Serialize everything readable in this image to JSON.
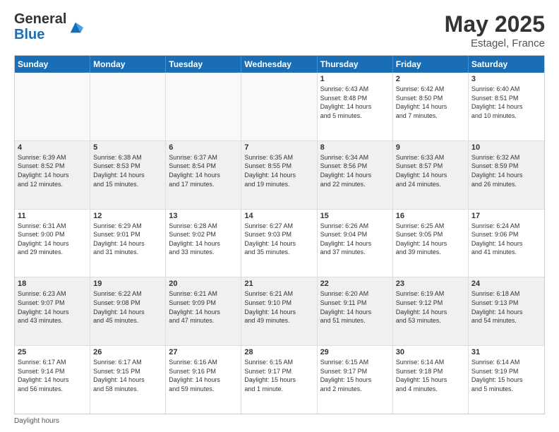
{
  "header": {
    "logo_general": "General",
    "logo_blue": "Blue",
    "month_year": "May 2025",
    "location": "Estagel, France"
  },
  "days_of_week": [
    "Sunday",
    "Monday",
    "Tuesday",
    "Wednesday",
    "Thursday",
    "Friday",
    "Saturday"
  ],
  "weeks": [
    [
      {
        "day": "",
        "info": "",
        "empty": true
      },
      {
        "day": "",
        "info": "",
        "empty": true
      },
      {
        "day": "",
        "info": "",
        "empty": true
      },
      {
        "day": "",
        "info": "",
        "empty": true
      },
      {
        "day": "1",
        "info": "Sunrise: 6:43 AM\nSunset: 8:48 PM\nDaylight: 14 hours\nand 5 minutes."
      },
      {
        "day": "2",
        "info": "Sunrise: 6:42 AM\nSunset: 8:50 PM\nDaylight: 14 hours\nand 7 minutes."
      },
      {
        "day": "3",
        "info": "Sunrise: 6:40 AM\nSunset: 8:51 PM\nDaylight: 14 hours\nand 10 minutes."
      }
    ],
    [
      {
        "day": "4",
        "info": "Sunrise: 6:39 AM\nSunset: 8:52 PM\nDaylight: 14 hours\nand 12 minutes."
      },
      {
        "day": "5",
        "info": "Sunrise: 6:38 AM\nSunset: 8:53 PM\nDaylight: 14 hours\nand 15 minutes."
      },
      {
        "day": "6",
        "info": "Sunrise: 6:37 AM\nSunset: 8:54 PM\nDaylight: 14 hours\nand 17 minutes."
      },
      {
        "day": "7",
        "info": "Sunrise: 6:35 AM\nSunset: 8:55 PM\nDaylight: 14 hours\nand 19 minutes."
      },
      {
        "day": "8",
        "info": "Sunrise: 6:34 AM\nSunset: 8:56 PM\nDaylight: 14 hours\nand 22 minutes."
      },
      {
        "day": "9",
        "info": "Sunrise: 6:33 AM\nSunset: 8:57 PM\nDaylight: 14 hours\nand 24 minutes."
      },
      {
        "day": "10",
        "info": "Sunrise: 6:32 AM\nSunset: 8:59 PM\nDaylight: 14 hours\nand 26 minutes."
      }
    ],
    [
      {
        "day": "11",
        "info": "Sunrise: 6:31 AM\nSunset: 9:00 PM\nDaylight: 14 hours\nand 29 minutes."
      },
      {
        "day": "12",
        "info": "Sunrise: 6:29 AM\nSunset: 9:01 PM\nDaylight: 14 hours\nand 31 minutes."
      },
      {
        "day": "13",
        "info": "Sunrise: 6:28 AM\nSunset: 9:02 PM\nDaylight: 14 hours\nand 33 minutes."
      },
      {
        "day": "14",
        "info": "Sunrise: 6:27 AM\nSunset: 9:03 PM\nDaylight: 14 hours\nand 35 minutes."
      },
      {
        "day": "15",
        "info": "Sunrise: 6:26 AM\nSunset: 9:04 PM\nDaylight: 14 hours\nand 37 minutes."
      },
      {
        "day": "16",
        "info": "Sunrise: 6:25 AM\nSunset: 9:05 PM\nDaylight: 14 hours\nand 39 minutes."
      },
      {
        "day": "17",
        "info": "Sunrise: 6:24 AM\nSunset: 9:06 PM\nDaylight: 14 hours\nand 41 minutes."
      }
    ],
    [
      {
        "day": "18",
        "info": "Sunrise: 6:23 AM\nSunset: 9:07 PM\nDaylight: 14 hours\nand 43 minutes."
      },
      {
        "day": "19",
        "info": "Sunrise: 6:22 AM\nSunset: 9:08 PM\nDaylight: 14 hours\nand 45 minutes."
      },
      {
        "day": "20",
        "info": "Sunrise: 6:21 AM\nSunset: 9:09 PM\nDaylight: 14 hours\nand 47 minutes."
      },
      {
        "day": "21",
        "info": "Sunrise: 6:21 AM\nSunset: 9:10 PM\nDaylight: 14 hours\nand 49 minutes."
      },
      {
        "day": "22",
        "info": "Sunrise: 6:20 AM\nSunset: 9:11 PM\nDaylight: 14 hours\nand 51 minutes."
      },
      {
        "day": "23",
        "info": "Sunrise: 6:19 AM\nSunset: 9:12 PM\nDaylight: 14 hours\nand 53 minutes."
      },
      {
        "day": "24",
        "info": "Sunrise: 6:18 AM\nSunset: 9:13 PM\nDaylight: 14 hours\nand 54 minutes."
      }
    ],
    [
      {
        "day": "25",
        "info": "Sunrise: 6:17 AM\nSunset: 9:14 PM\nDaylight: 14 hours\nand 56 minutes."
      },
      {
        "day": "26",
        "info": "Sunrise: 6:17 AM\nSunset: 9:15 PM\nDaylight: 14 hours\nand 58 minutes."
      },
      {
        "day": "27",
        "info": "Sunrise: 6:16 AM\nSunset: 9:16 PM\nDaylight: 14 hours\nand 59 minutes."
      },
      {
        "day": "28",
        "info": "Sunrise: 6:15 AM\nSunset: 9:17 PM\nDaylight: 15 hours\nand 1 minute."
      },
      {
        "day": "29",
        "info": "Sunrise: 6:15 AM\nSunset: 9:17 PM\nDaylight: 15 hours\nand 2 minutes."
      },
      {
        "day": "30",
        "info": "Sunrise: 6:14 AM\nSunset: 9:18 PM\nDaylight: 15 hours\nand 4 minutes."
      },
      {
        "day": "31",
        "info": "Sunrise: 6:14 AM\nSunset: 9:19 PM\nDaylight: 15 hours\nand 5 minutes."
      }
    ]
  ],
  "footer": {
    "daylight_label": "Daylight hours"
  }
}
